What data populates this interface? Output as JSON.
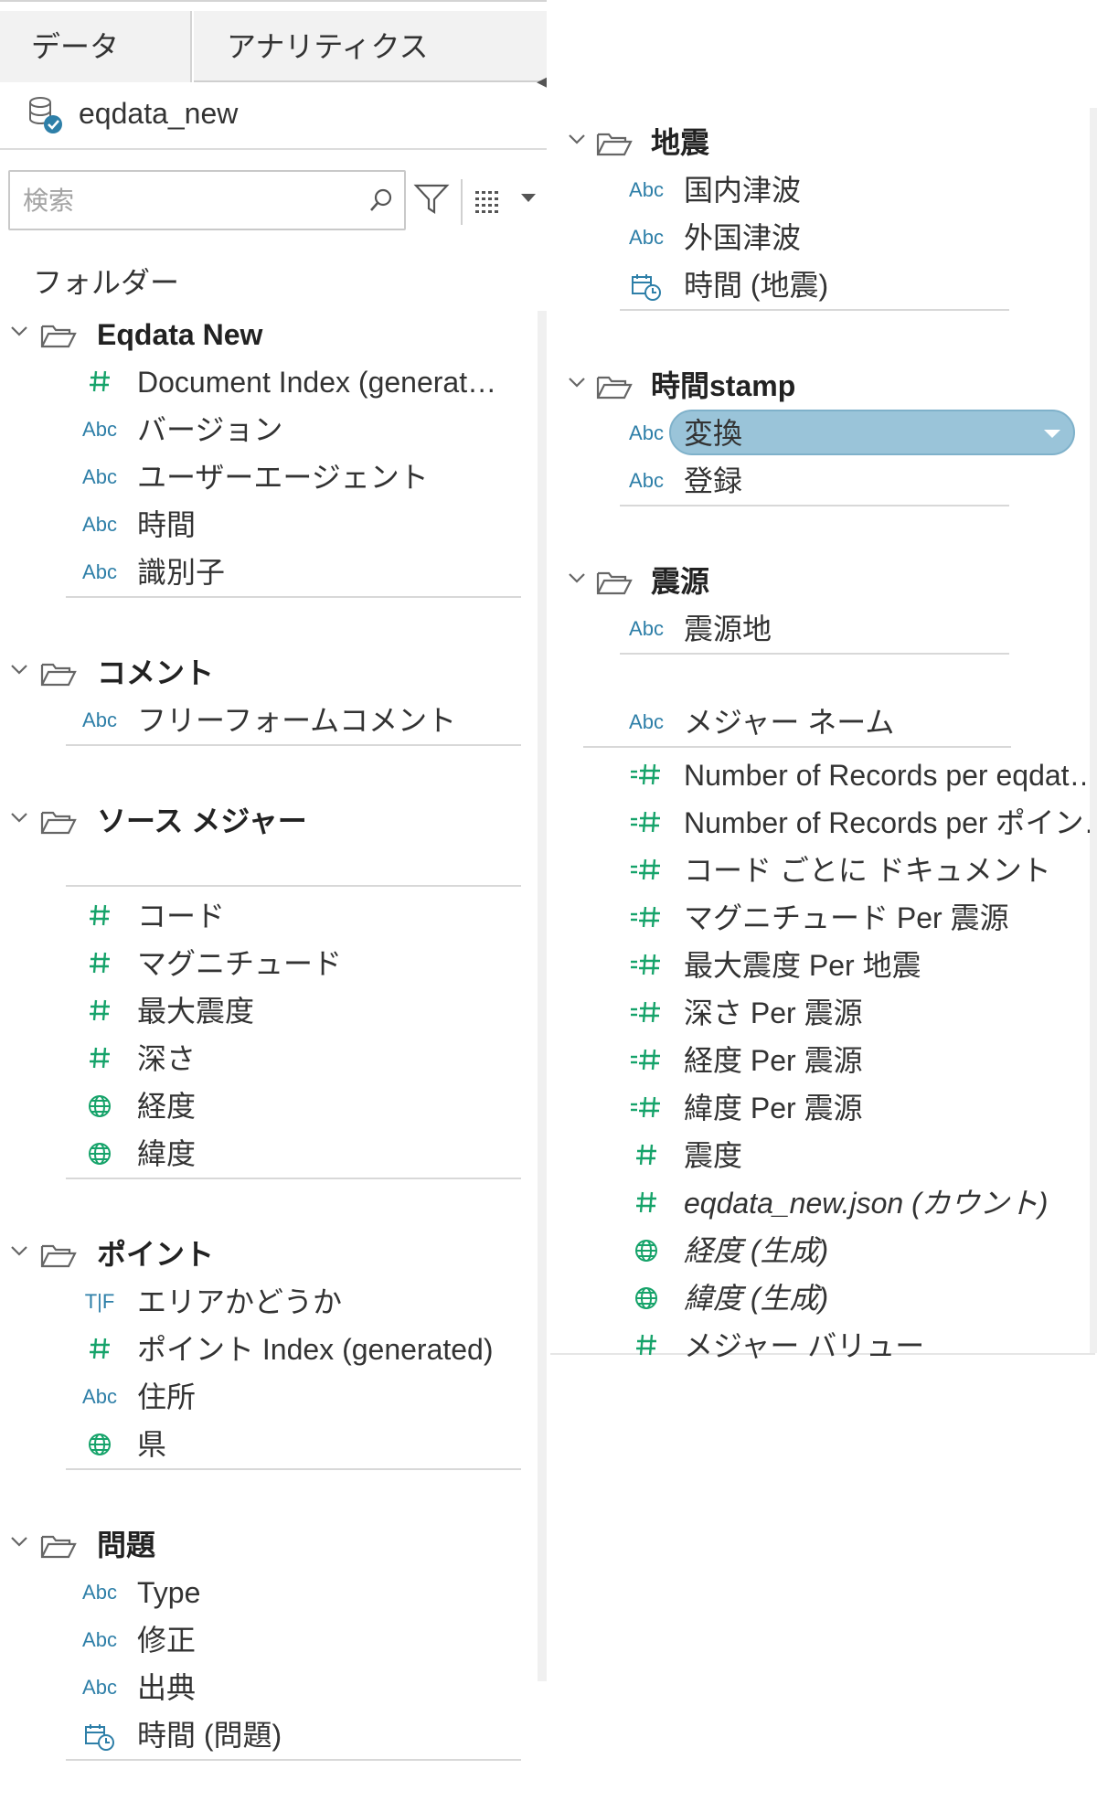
{
  "tabs": [
    {
      "label": "データ",
      "active": true
    },
    {
      "label": "アナリティクス",
      "active": false
    }
  ],
  "data_source": {
    "name": "eqdata_new",
    "icon": "data-source-live-icon"
  },
  "search": {
    "placeholder": "検索",
    "value": ""
  },
  "folders_label": "フォルダー",
  "left_groups": [
    {
      "title": "Eqdata New",
      "fields": [
        {
          "type": "#",
          "name": "Document Index (generat…",
          "kind": "measure"
        },
        {
          "type": "Abc",
          "name": "バージョン",
          "kind": "dimension"
        },
        {
          "type": "Abc",
          "name": "ユーザーエージェント",
          "kind": "dimension"
        },
        {
          "type": "Abc",
          "name": "時間",
          "kind": "dimension"
        },
        {
          "type": "Abc",
          "name": "識別子",
          "kind": "dimension"
        }
      ]
    },
    {
      "title": "コメント",
      "fields": [
        {
          "type": "Abc",
          "name": "フリーフォームコメント",
          "kind": "dimension"
        }
      ]
    },
    {
      "title": "ソース メジャー",
      "fields": [
        {
          "type": "#",
          "name": "コード",
          "kind": "measure"
        },
        {
          "type": "#",
          "name": "マグニチュード",
          "kind": "measure"
        },
        {
          "type": "#",
          "name": "最大震度",
          "kind": "measure"
        },
        {
          "type": "#",
          "name": "深さ",
          "kind": "measure"
        },
        {
          "type": "globe",
          "name": "経度",
          "kind": "geo"
        },
        {
          "type": "globe",
          "name": "緯度",
          "kind": "geo"
        }
      ]
    },
    {
      "title": "ポイント",
      "fields": [
        {
          "type": "T|F",
          "name": "エリアかどうか",
          "kind": "boolean"
        },
        {
          "type": "#",
          "name": "ポイント Index (generated)",
          "kind": "measure"
        },
        {
          "type": "Abc",
          "name": "住所",
          "kind": "dimension"
        },
        {
          "type": "globe",
          "name": "県",
          "kind": "geo"
        }
      ]
    },
    {
      "title": "問題",
      "fields": [
        {
          "type": "Abc",
          "name": "Type",
          "kind": "dimension"
        },
        {
          "type": "Abc",
          "name": "修正",
          "kind": "dimension"
        },
        {
          "type": "Abc",
          "name": "出典",
          "kind": "dimension"
        },
        {
          "type": "date",
          "name": "時間 (問題)",
          "kind": "date"
        }
      ]
    }
  ],
  "right_groups": [
    {
      "title": "地震",
      "fields": [
        {
          "type": "Abc",
          "name": "国内津波",
          "kind": "dimension"
        },
        {
          "type": "Abc",
          "name": "外国津波",
          "kind": "dimension"
        },
        {
          "type": "date",
          "name": "時間 (地震)",
          "kind": "date"
        }
      ]
    },
    {
      "title": "時間stamp",
      "fields": [
        {
          "type": "Abc",
          "name": "変換",
          "kind": "dimension",
          "selected": true
        },
        {
          "type": "Abc",
          "name": "登録",
          "kind": "dimension"
        }
      ]
    },
    {
      "title": "震源",
      "fields": [
        {
          "type": "Abc",
          "name": "震源地",
          "kind": "dimension"
        }
      ]
    }
  ],
  "measure_names": {
    "type": "Abc",
    "name": "メジャー ネーム"
  },
  "measures": [
    {
      "type": "=#",
      "name": "Number of Records per eqdat…",
      "italic": false
    },
    {
      "type": "=#",
      "name": "Number of Records per ポイン…",
      "italic": false
    },
    {
      "type": "=#",
      "name": "コード ごとに ドキュメント",
      "italic": false
    },
    {
      "type": "=#",
      "name": "マグニチュード Per 震源",
      "italic": false
    },
    {
      "type": "=#",
      "name": "最大震度 Per 地震",
      "italic": false
    },
    {
      "type": "=#",
      "name": "深さ Per 震源",
      "italic": false
    },
    {
      "type": "=#",
      "name": "経度 Per 震源",
      "italic": false
    },
    {
      "type": "=#",
      "name": "緯度 Per 震源",
      "italic": false
    },
    {
      "type": "#",
      "name": "震度",
      "italic": false
    },
    {
      "type": "#",
      "name": "eqdata_new.json (カウント)",
      "italic": true
    },
    {
      "type": "globe",
      "name": "経度 (生成)",
      "italic": true
    },
    {
      "type": "globe",
      "name": "緯度 (生成)",
      "italic": true
    },
    {
      "type": "#",
      "name": "メジャー バリュー",
      "italic": false
    }
  ],
  "colors": {
    "dimension": "#2e7fa8",
    "measure": "#16a36a",
    "selected_pill": "#9ac4d9"
  }
}
